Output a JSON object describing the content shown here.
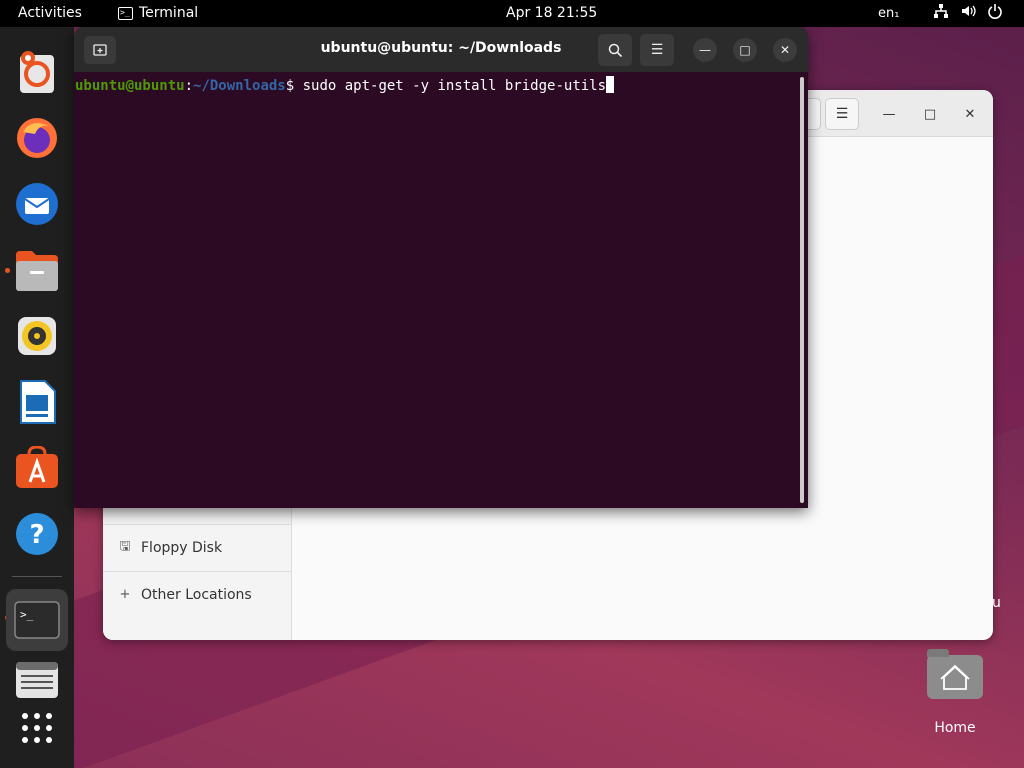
{
  "topbar": {
    "activities": "Activities",
    "app_name": "Terminal",
    "app_icon": "terminal-icon",
    "clock": "Apr 18  21:55",
    "language": "en₁",
    "system_icons": [
      "network-icon",
      "volume-icon",
      "power-icon"
    ]
  },
  "dock": {
    "items": [
      {
        "name": "help-lifebuoy",
        "icon": "lifebuoy-icon"
      },
      {
        "name": "firefox",
        "icon": "firefox-icon"
      },
      {
        "name": "thunderbird",
        "icon": "thunderbird-icon"
      },
      {
        "name": "files",
        "icon": "files-icon",
        "running": true
      },
      {
        "name": "rhythmbox",
        "icon": "rhythmbox-icon"
      },
      {
        "name": "libreoffice-writer",
        "icon": "writer-icon"
      },
      {
        "name": "app-center",
        "icon": "app-center-icon"
      },
      {
        "name": "help",
        "icon": "help-icon"
      },
      {
        "name": "terminal",
        "icon": "terminal-icon",
        "running": true,
        "active": true
      },
      {
        "name": "text-editor",
        "icon": "text-editor-icon"
      },
      {
        "name": "show-apps",
        "icon": "app-grid-icon"
      }
    ]
  },
  "terminal": {
    "title": "ubuntu@ubuntu: ~/Downloads",
    "prompt_user": "ubuntu@ubuntu",
    "prompt_sep": ":",
    "prompt_path": "~/Downloads",
    "prompt_symbol": "$ ",
    "command": "sudo apt-get -y install bridge-utils"
  },
  "files": {
    "sidebar": [
      {
        "label": "Floppy Disk",
        "icon": "floppy-icon"
      },
      {
        "label": "Other Locations",
        "icon": "plus-icon"
      }
    ]
  },
  "desktop": {
    "home_label": "Home",
    "edge_text": "u"
  },
  "colors": {
    "terminal_bg": "#2c0a23",
    "prompt_user": "#4e9a06",
    "prompt_path": "#3465a4",
    "accent": "#e95420"
  }
}
